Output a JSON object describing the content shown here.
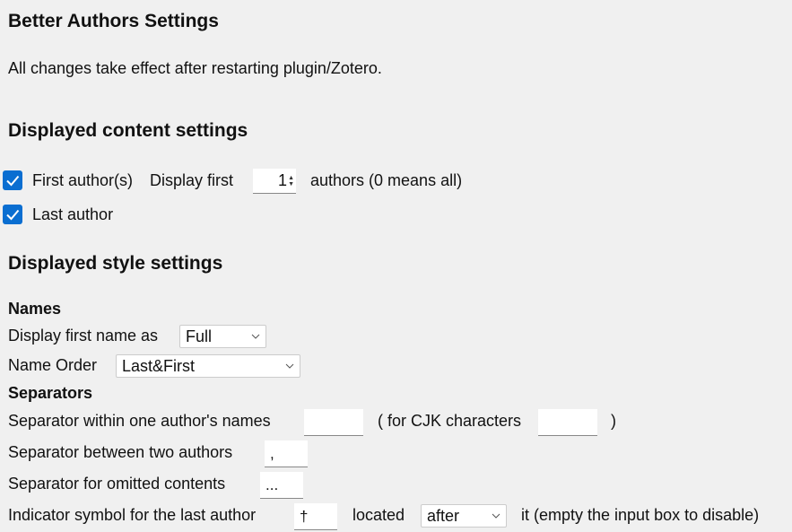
{
  "header": {
    "title": "Better Authors Settings",
    "notice": "All changes take effect after restarting plugin/Zotero."
  },
  "content_settings": {
    "heading": "Displayed content settings",
    "first_author": {
      "label": "First author(s)",
      "checked": true,
      "display_first_label": "Display first",
      "count_value": "1",
      "suffix": "authors (0 means all)"
    },
    "last_author": {
      "label": "Last author",
      "checked": true
    }
  },
  "style_settings": {
    "heading": "Displayed style settings",
    "names": {
      "heading": "Names",
      "first_name_label": "Display first name as",
      "first_name_value": "Full",
      "name_order_label": "Name Order",
      "name_order_value": "Last&First"
    },
    "separators": {
      "heading": "Separators",
      "within_label": "Separator within one author's names",
      "within_value": "",
      "cjk_label": "( for CJK characters",
      "cjk_value": "",
      "cjk_close": ")",
      "between_label": "Separator between two authors",
      "between_value": ",",
      "omitted_label": "Separator for omitted contents",
      "omitted_value": "...",
      "indicator_label": "Indicator symbol for the last author",
      "indicator_value": "†",
      "located_label": "located",
      "located_value": "after",
      "indicator_suffix": "it (empty the input box to disable)"
    }
  },
  "colors": {
    "accent": "#0a6ed1",
    "background": "#f0f0f0"
  }
}
